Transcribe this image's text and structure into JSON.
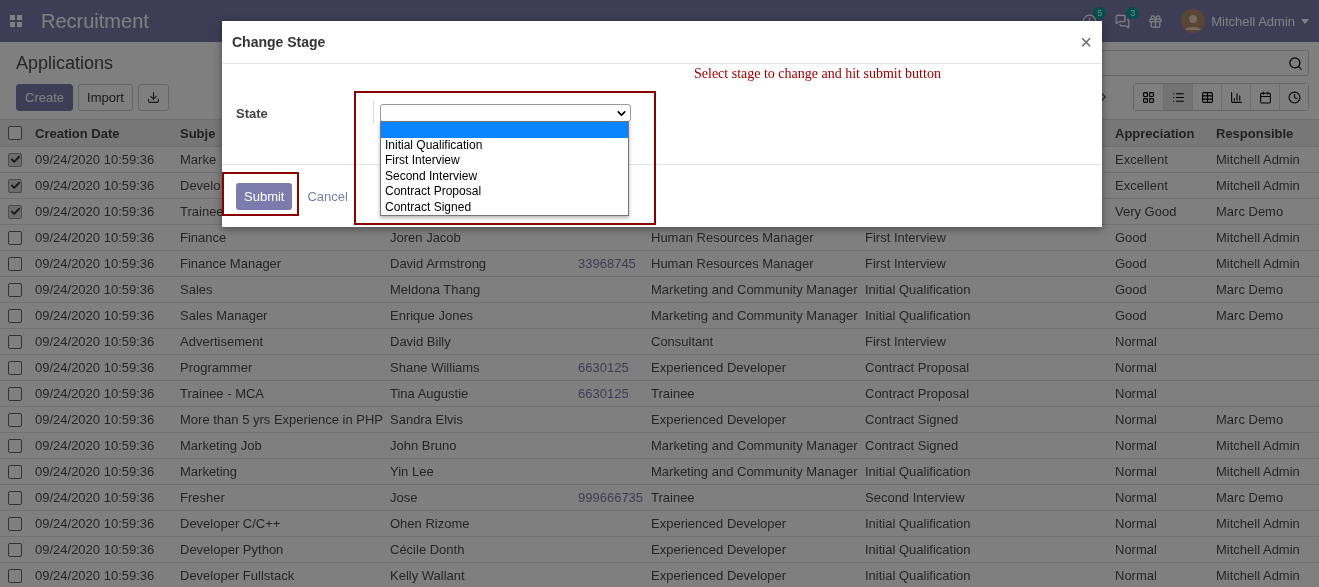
{
  "navbar": {
    "app_title": "Recruitment",
    "activity_count": "5",
    "message_count": "3",
    "user": "Mitchell Admin"
  },
  "control_panel": {
    "title": "Applications",
    "create": "Create",
    "import": "Import"
  },
  "views": [
    {
      "kind": "kanban",
      "selected": false
    },
    {
      "kind": "list",
      "selected": true
    },
    {
      "kind": "pivot",
      "selected": false
    },
    {
      "kind": "graph",
      "selected": false
    },
    {
      "kind": "calendar",
      "selected": false
    },
    {
      "kind": "activity",
      "selected": false
    }
  ],
  "table": {
    "columns": {
      "creation_date": "Creation Date",
      "subject": "Subje",
      "appreciation": "Appreciation",
      "responsible": "Responsible"
    },
    "header_checked": false,
    "rows": [
      {
        "checked": true,
        "date": "09/24/2020 10:59:36",
        "subject": "Marke",
        "appreciation": "Excellent",
        "responsible": "Mitchell Admin"
      },
      {
        "checked": true,
        "date": "09/24/2020 10:59:36",
        "subject": "Develo",
        "appreciation": "Excellent",
        "responsible": "Mitchell Admin"
      },
      {
        "checked": true,
        "date": "09/24/2020 10:59:36",
        "subject": "Trainee",
        "appreciation": "Very Good",
        "responsible": "Marc Demo"
      },
      {
        "checked": false,
        "date": "09/24/2020 10:59:36",
        "subject": "Finance",
        "applicant": "Joren Jacob",
        "job": "Human Resources Manager",
        "stage": "First Interview",
        "appreciation": "Good",
        "responsible": "Mitchell Admin"
      },
      {
        "checked": false,
        "date": "09/24/2020 10:59:36",
        "subject": "Finance Manager",
        "applicant": "David Armstrong",
        "phone": "33968745",
        "job": "Human Resources Manager",
        "stage": "First Interview",
        "appreciation": "Good",
        "responsible": "Mitchell Admin"
      },
      {
        "checked": false,
        "date": "09/24/2020 10:59:36",
        "subject": "Sales",
        "applicant": "Meldona Thang",
        "job": "Marketing and Community Manager",
        "stage": "Initial Qualification",
        "appreciation": "Good",
        "responsible": "Marc Demo"
      },
      {
        "checked": false,
        "date": "09/24/2020 10:59:36",
        "subject": "Sales Manager",
        "applicant": "Enrique Jones",
        "job": "Marketing and Community Manager",
        "stage": "Initial Qualification",
        "appreciation": "Good",
        "responsible": "Marc Demo"
      },
      {
        "checked": false,
        "date": "09/24/2020 10:59:36",
        "subject": "Advertisement",
        "applicant": "David Billy",
        "job": "Consultant",
        "stage": "First Interview",
        "appreciation": "Normal"
      },
      {
        "checked": false,
        "date": "09/24/2020 10:59:36",
        "subject": "Programmer",
        "applicant": "Shane Williams",
        "phone": "6630125",
        "job": "Experienced Developer",
        "stage": "Contract Proposal",
        "appreciation": "Normal"
      },
      {
        "checked": false,
        "date": "09/24/2020 10:59:36",
        "subject": "Trainee - MCA",
        "applicant": "Tina Augustie",
        "phone": "6630125",
        "job": "Trainee",
        "stage": "Contract Proposal",
        "appreciation": "Normal"
      },
      {
        "checked": false,
        "date": "09/24/2020 10:59:36",
        "subject": "More than 5 yrs Experience in PHP",
        "applicant": "Sandra Elvis",
        "job": "Experienced Developer",
        "stage": "Contract Signed",
        "appreciation": "Normal",
        "responsible": "Marc Demo"
      },
      {
        "checked": false,
        "date": "09/24/2020 10:59:36",
        "subject": "Marketing Job",
        "applicant": "John Bruno",
        "job": "Marketing and Community Manager",
        "stage": "Contract Signed",
        "appreciation": "Normal",
        "responsible": "Mitchell Admin"
      },
      {
        "checked": false,
        "date": "09/24/2020 10:59:36",
        "subject": "Marketing",
        "applicant": "Yin Lee",
        "job": "Marketing and Community Manager",
        "stage": "Initial Qualification",
        "appreciation": "Normal",
        "responsible": "Mitchell Admin"
      },
      {
        "checked": false,
        "date": "09/24/2020 10:59:36",
        "subject": "Fresher",
        "applicant": "Jose",
        "phone": "999666735",
        "job": "Trainee",
        "stage": "Second Interview",
        "appreciation": "Normal",
        "responsible": "Marc Demo"
      },
      {
        "checked": false,
        "date": "09/24/2020 10:59:36",
        "subject": "Developer C/C++",
        "applicant": "Ohen Rizome",
        "job": "Experienced Developer",
        "stage": "Initial Qualification",
        "appreciation": "Normal",
        "responsible": "Mitchell Admin"
      },
      {
        "checked": false,
        "date": "09/24/2020 10:59:36",
        "subject": "Developer Python",
        "applicant": "Cécile Donth",
        "job": "Experienced Developer",
        "stage": "Initial Qualification",
        "appreciation": "Normal",
        "responsible": "Mitchell Admin"
      },
      {
        "checked": false,
        "date": "09/24/2020 10:59:36",
        "subject": "Developer Fullstack",
        "applicant": "Kelly Wallant",
        "job": "Experienced Developer",
        "stage": "Initial Qualification",
        "appreciation": "Normal",
        "responsible": "Mitchell Admin"
      }
    ]
  },
  "dialog": {
    "title": "Change Stage",
    "close": "×",
    "hint": "Select stage to change and hit submit button",
    "field_label": "State",
    "blank_option_selected": true,
    "options": [
      {
        "label": "Initial Qualification",
        "selected": false
      },
      {
        "label": "First Interview",
        "selected": false
      },
      {
        "label": "Second Interview",
        "selected": false
      },
      {
        "label": "Contract Proposal",
        "selected": false
      },
      {
        "label": "Contract Signed",
        "selected": false
      }
    ],
    "submit": "Submit",
    "cancel": "Cancel"
  }
}
